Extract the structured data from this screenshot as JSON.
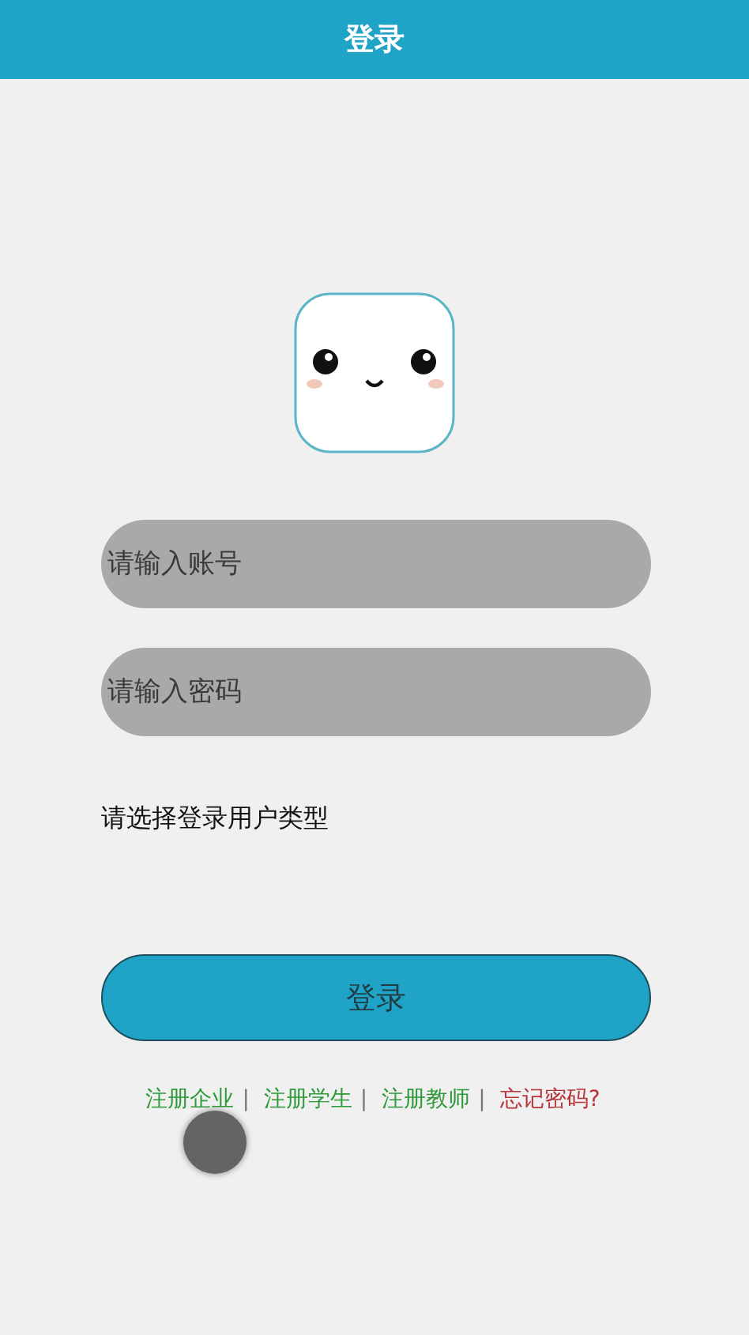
{
  "header": {
    "title": "登录"
  },
  "form": {
    "account": {
      "placeholder": "请输入账号"
    },
    "password": {
      "placeholder": "请输入密码"
    },
    "user_type_label": "请选择登录用户类型",
    "submit": "登录"
  },
  "links": [
    {
      "label": "注册企业",
      "color": "#2e9a3a",
      "separator": "|"
    },
    {
      "label": "注册学生",
      "color": "#2e9a3a",
      "separator": "|"
    },
    {
      "label": "注册教师",
      "color": "#2e9a3a",
      "separator": "|"
    },
    {
      "label": "忘记密码?",
      "color": "#b8343c"
    }
  ],
  "touch_indicator": {
    "visible": true
  }
}
